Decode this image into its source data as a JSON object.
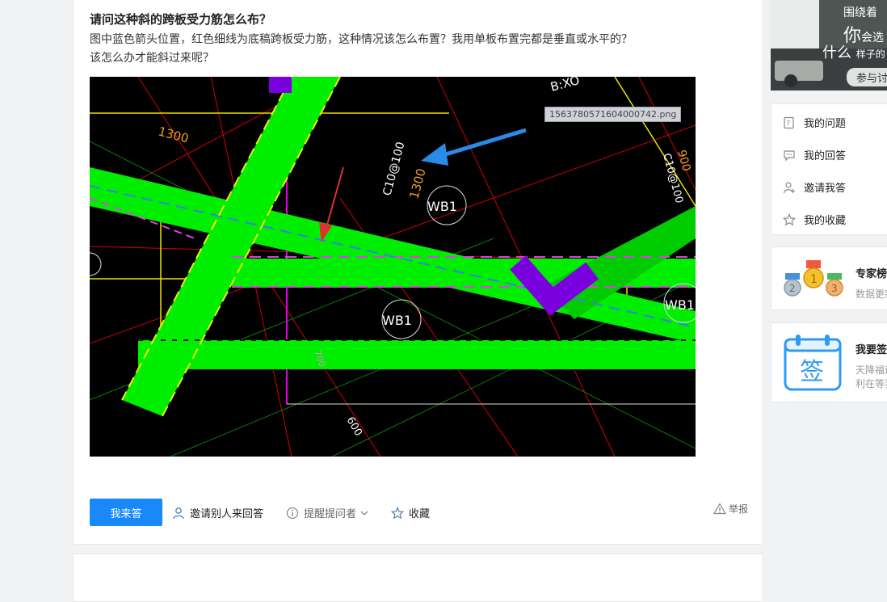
{
  "question": {
    "title": "请问这种斜的跨板受力筋怎么布？",
    "description_line1": "图中蓝色箭头位置，红色细线为底稿跨板受力筋，这种情况该怎么布置？我用单板布置完都是垂直或水平的？",
    "description_line2": "该怎么办才能斜过来呢？"
  },
  "image": {
    "tooltip": "1563780571604000742.png",
    "labels": {
      "dim_1300_a": "1300",
      "dim_1300_b": "1300",
      "rebar_c10_a": "C10@100",
      "rebar_c10_b": "C10@100",
      "dim_900": "900",
      "dim_600": "600",
      "dim_700": "700",
      "wb1_a": "WB1",
      "wb1_b": "WB1",
      "wb1_c": "WB1",
      "axis_b": "B:XO"
    }
  },
  "actions": {
    "answer": "我来答",
    "invite": "邀请别人来回答",
    "remind": "提醒提问者",
    "favorite": "收藏",
    "report": "举报"
  },
  "sidebar": {
    "banner": {
      "line1": "围绕着",
      "line2_big": "你",
      "line2_small": "会选",
      "line3_big": "什么",
      "line3_small": "样子的",
      "button": "参与讨"
    },
    "menu": [
      {
        "label": "我的问题",
        "icon": "question-doc-icon"
      },
      {
        "label": "我的回答",
        "icon": "comment-icon"
      },
      {
        "label": "邀请我答",
        "icon": "invite-user-icon"
      },
      {
        "label": "我的收藏",
        "icon": "star-icon"
      }
    ],
    "expert": {
      "title": "专家榜",
      "subtitle": "数据更新"
    },
    "signin": {
      "title": "我要签",
      "sub1": "天降福运",
      "sub2": "利在等我",
      "glyph": "签"
    }
  }
}
